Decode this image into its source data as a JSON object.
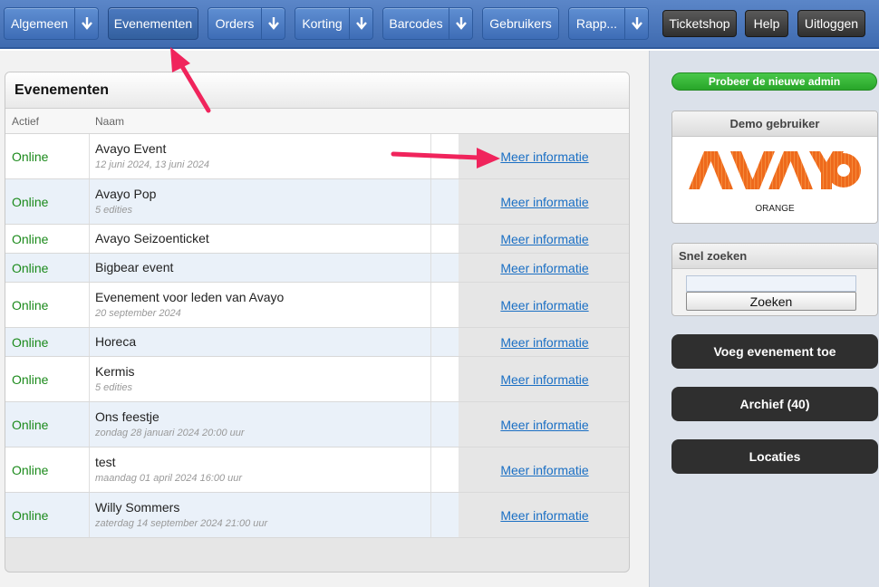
{
  "nav": {
    "items": [
      {
        "label": "Algemeen",
        "has_arrow": true
      },
      {
        "label": "Evenementen",
        "has_arrow": false
      },
      {
        "label": "Orders",
        "has_arrow": true
      },
      {
        "label": "Korting",
        "has_arrow": true
      },
      {
        "label": "Barcodes",
        "has_arrow": true
      },
      {
        "label": "Gebruikers",
        "has_arrow": false
      },
      {
        "label": "Rapp...",
        "has_arrow": true
      }
    ],
    "right": [
      {
        "label": "Ticketshop"
      },
      {
        "label": "Help"
      },
      {
        "label": "Uitloggen"
      }
    ]
  },
  "panel": {
    "title": "Evenementen",
    "col_actief": "Actief",
    "col_naam": "Naam",
    "rows": [
      {
        "status": "Online",
        "name": "Avayo Event",
        "sub": "12 juni 2024, 13 juni 2024",
        "link": "Meer informatie"
      },
      {
        "status": "Online",
        "name": "Avayo Pop",
        "sub": "5 edities",
        "link": "Meer informatie"
      },
      {
        "status": "Online",
        "name": "Avayo Seizoenticket",
        "sub": "",
        "link": "Meer informatie"
      },
      {
        "status": "Online",
        "name": "Bigbear event",
        "sub": "",
        "link": "Meer informatie"
      },
      {
        "status": "Online",
        "name": "Evenement voor leden van Avayo",
        "sub": "20 september 2024",
        "link": "Meer informatie"
      },
      {
        "status": "Online",
        "name": "Horeca",
        "sub": "",
        "link": "Meer informatie"
      },
      {
        "status": "Online",
        "name": "Kermis",
        "sub": "5 edities",
        "link": "Meer informatie"
      },
      {
        "status": "Online",
        "name": "Ons feestje",
        "sub": "zondag 28 januari 2024 20:00 uur",
        "link": "Meer informatie"
      },
      {
        "status": "Online",
        "name": "test",
        "sub": "maandag 01 april 2024 16:00 uur",
        "link": "Meer informatie"
      },
      {
        "status": "Online",
        "name": "Willy Sommers",
        "sub": "zaterdag 14 september 2024 21:00 uur",
        "link": "Meer informatie"
      }
    ]
  },
  "sidebar": {
    "try_admin": "Probeer de nieuwe admin",
    "demo_title": "Demo gebruiker",
    "logo_caption": "ORANGE",
    "search_title": "Snel zoeken",
    "search_value": "",
    "search_button": "Zoeken",
    "add_event": "Voeg evenement toe",
    "archive": "Archief (40)",
    "locations": "Locaties"
  },
  "colors": {
    "nav_blue": "#4a78bd",
    "online_green": "#1b8a1b",
    "link_blue": "#1a6fc4",
    "logo_orange": "#ee6a1c",
    "annotation_arrow": "#f0245c"
  },
  "icons": [
    "down-arrow-icon",
    "annotation-arrow"
  ]
}
